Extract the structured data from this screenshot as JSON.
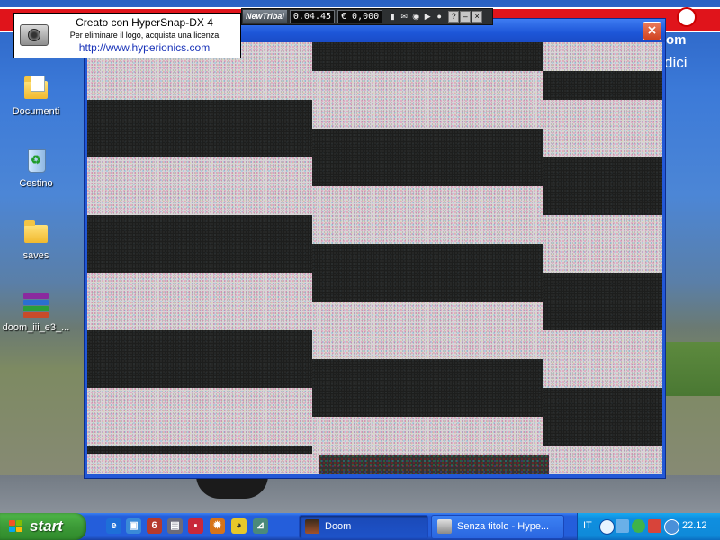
{
  "desktop": {
    "wallpaper_text": {
      "right_top": "om",
      "right_bottom": "dici"
    },
    "icons": [
      {
        "label": "Documenti",
        "icon": "documents-folder-icon"
      },
      {
        "label": "Cestino",
        "icon": "recycle-bin-icon"
      },
      {
        "label": "saves",
        "icon": "folder-icon"
      },
      {
        "label": "doom_iii_e3_...",
        "icon": "winrar-archive-icon"
      }
    ]
  },
  "hypersnap_watermark": {
    "line1": "Creato con HyperSnap-DX 4",
    "line2": "Per eliminare il logo, acquista una licenza",
    "line3": "http://www.hyperionics.com"
  },
  "tribal_toolbar": {
    "brand": "NewTribal",
    "time": "0.04.45",
    "cost": "€ 0,000",
    "buttons": [
      "bars-icon",
      "mail-icon",
      "rewind-icon",
      "play-icon",
      "chat-icon"
    ],
    "help_label": "?",
    "minimize_label": "–",
    "close_label": "×"
  },
  "doom_window": {
    "title": "",
    "close_label": "×"
  },
  "taskbar": {
    "start_label": "start",
    "quick_launch": [
      "internet-explorer-icon",
      "desktop-icon",
      "player-icon",
      "app-icon",
      "save-icon",
      "sun-icon",
      "duck-icon",
      "tool-icon"
    ],
    "tasks": [
      {
        "label": "Doom",
        "icon": "doom-icon",
        "active": true
      },
      {
        "label": "Senza titolo - Hype...",
        "icon": "hypersnap-icon",
        "active": false
      }
    ],
    "tray": {
      "language": "IT",
      "icons": [
        "arrow-left-icon",
        "network-icon",
        "frog-icon",
        "x-icon",
        "globe-icon"
      ],
      "clock": "22.12"
    }
  },
  "colors": {
    "taskbar_blue": "#245edb",
    "start_green": "#3c9a37",
    "close_red": "#d1421f",
    "banner_red": "#e0141b"
  }
}
